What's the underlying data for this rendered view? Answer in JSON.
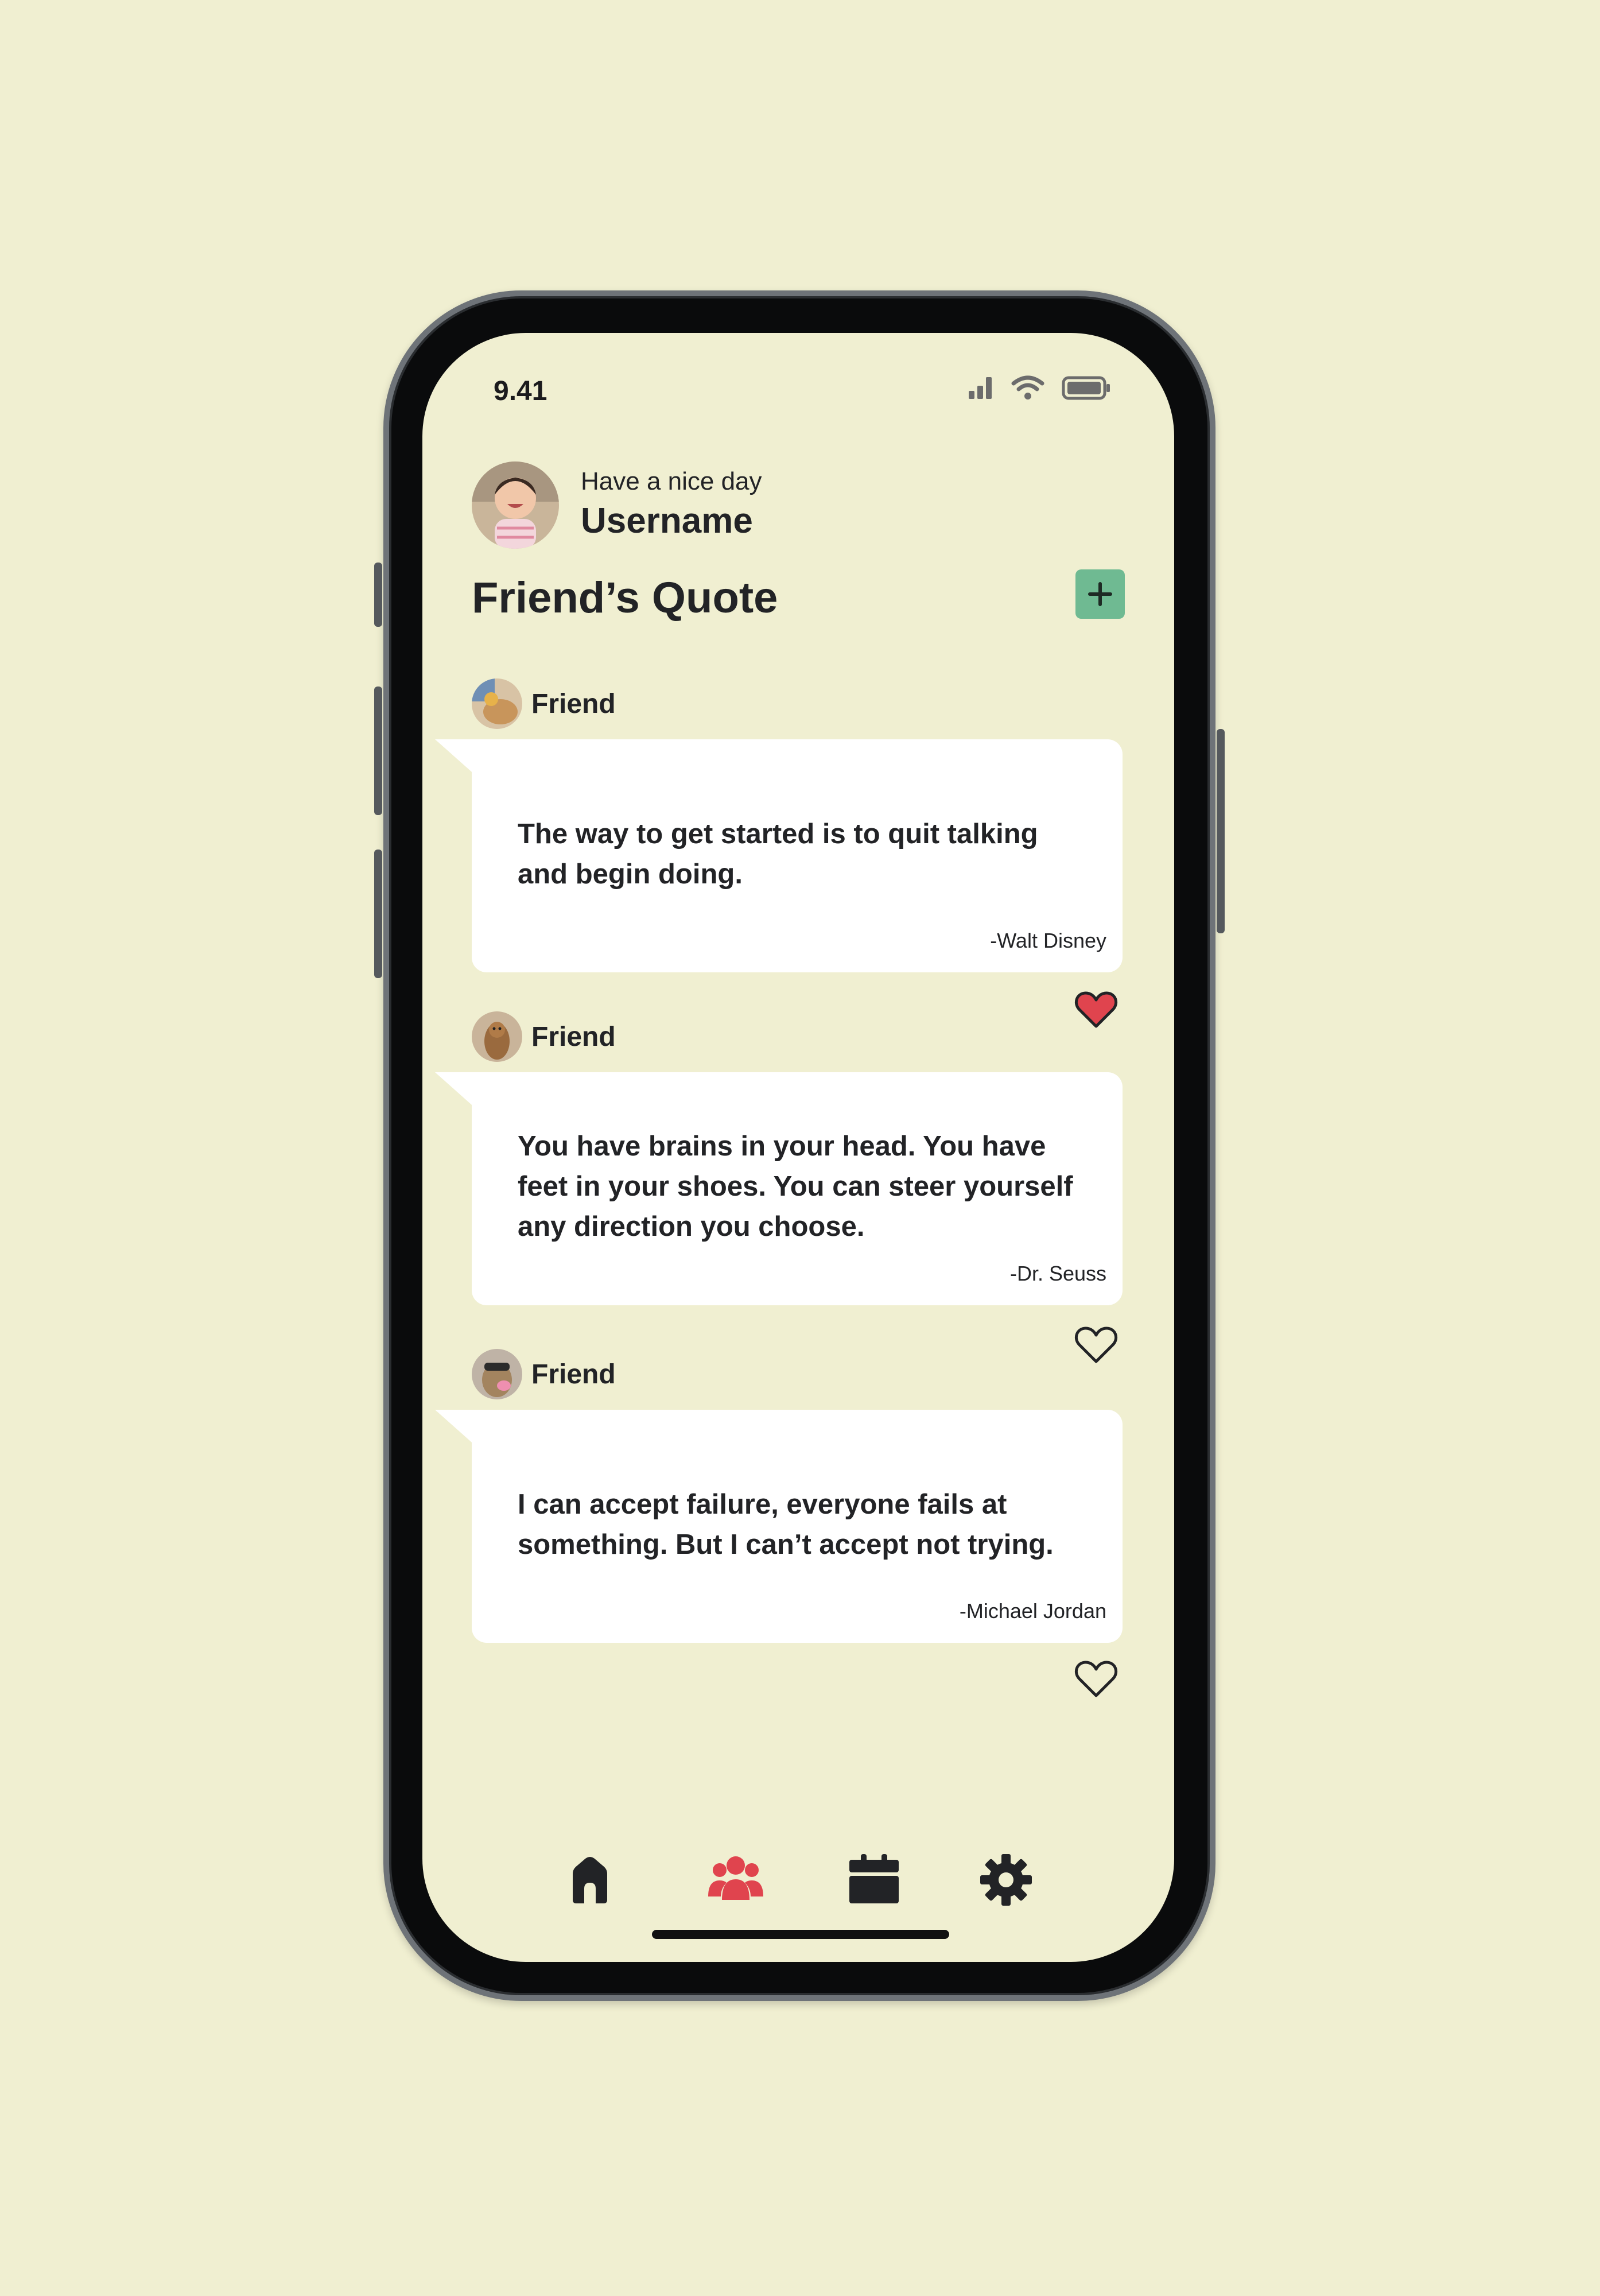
{
  "status_bar": {
    "time": "9.41"
  },
  "header": {
    "greeting": "Have a nice day",
    "username": "Username",
    "page_title": "Friend’s Quote"
  },
  "quotes": [
    {
      "friend": "Friend",
      "text": "The way to get started is to quit talking and begin doing.",
      "author": "-Walt Disney",
      "liked": true
    },
    {
      "friend": "Friend",
      "text": "You have brains in your head. You have feet in your shoes. You can steer yourself any direction you choose.",
      "author": "-Dr. Seuss",
      "liked": false
    },
    {
      "friend": "Friend",
      "text": "I can accept failure, everyone fails at something. But I can’t accept not trying.",
      "author": "-Michael Jordan",
      "liked": false
    }
  ],
  "nav": {
    "items": [
      "home-icon",
      "friends-icon",
      "calendar-icon",
      "settings-icon"
    ],
    "active": "friends-icon"
  },
  "colors": {
    "background": "#f0efd1",
    "accent_red": "#e0444e",
    "add_button": "#6fba92",
    "text": "#222326",
    "card": "#ffffff"
  }
}
